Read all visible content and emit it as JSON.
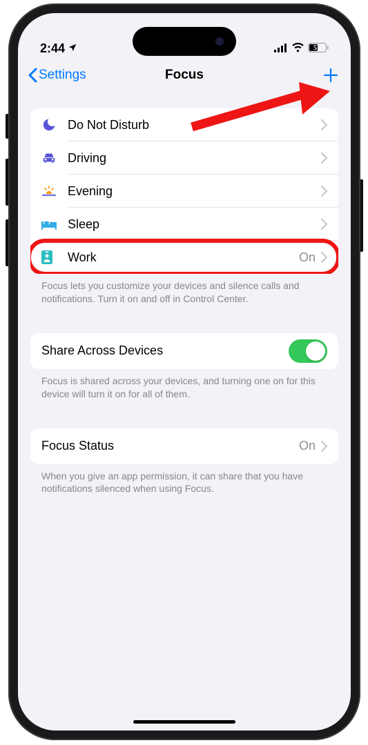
{
  "status_bar": {
    "time": "2:44",
    "battery": "51"
  },
  "nav": {
    "back_label": "Settings",
    "title": "Focus"
  },
  "focus_modes": [
    {
      "icon": "moon",
      "color": "#5856d6",
      "label": "Do Not Disturb",
      "status": ""
    },
    {
      "icon": "car",
      "color": "#5856d6",
      "label": "Driving",
      "status": ""
    },
    {
      "icon": "sunset",
      "color": "#ff9500",
      "label": "Evening",
      "status": ""
    },
    {
      "icon": "bed",
      "color": "#30d158",
      "label": "Sleep",
      "status": ""
    },
    {
      "icon": "badge",
      "color": "#29BDC1",
      "label": "Work",
      "status": "On"
    }
  ],
  "focus_footer": "Focus lets you customize your devices and silence calls and notifications. Turn it on and off in Control Center.",
  "share": {
    "label": "Share Across Devices",
    "enabled": true,
    "footer": "Focus is shared across your devices, and turning one on for this device will turn it on for all of them."
  },
  "status_section": {
    "label": "Focus Status",
    "value": "On",
    "footer": "When you give an app permission, it can share that you have notifications silenced when using Focus."
  }
}
